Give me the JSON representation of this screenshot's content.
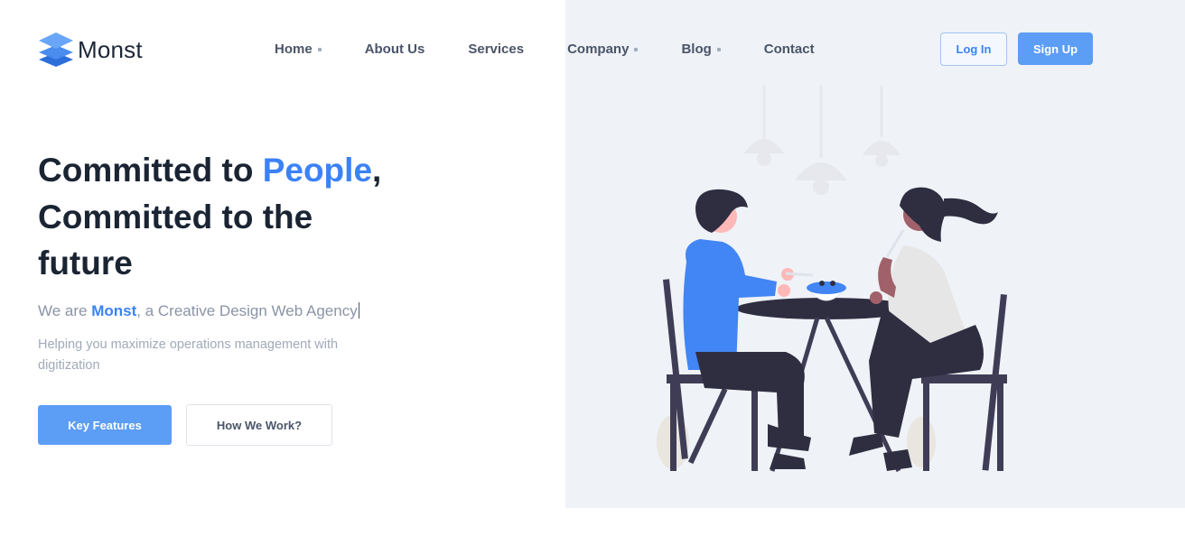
{
  "brand": {
    "name": "Monst",
    "accent_color": "#3b82f6",
    "button_color": "#5c9df5"
  },
  "nav": {
    "items": [
      {
        "label": "Home",
        "has_dropdown": true
      },
      {
        "label": "About Us",
        "has_dropdown": false
      },
      {
        "label": "Services",
        "has_dropdown": false
      },
      {
        "label": "Company",
        "has_dropdown": true
      },
      {
        "label": "Blog",
        "has_dropdown": true
      },
      {
        "label": "Contact",
        "has_dropdown": false
      }
    ]
  },
  "auth": {
    "login_label": "Log In",
    "signup_label": "Sign Up"
  },
  "hero": {
    "headline_part1": "Committed to ",
    "headline_accent": "People",
    "headline_part2": ",",
    "headline_line2": "Committed to the",
    "headline_line3": "future",
    "tagline_prefix": "We are ",
    "tagline_brand": "Monst",
    "tagline_suffix": ", a Creative Design Web Agency",
    "subtext": "Helping you maximize operations management with digitization",
    "primary_button": "Key Features",
    "secondary_button": "How We Work?"
  },
  "illustration": {
    "icon": "people-at-table-illustration",
    "background_color": "#eff2f7"
  }
}
